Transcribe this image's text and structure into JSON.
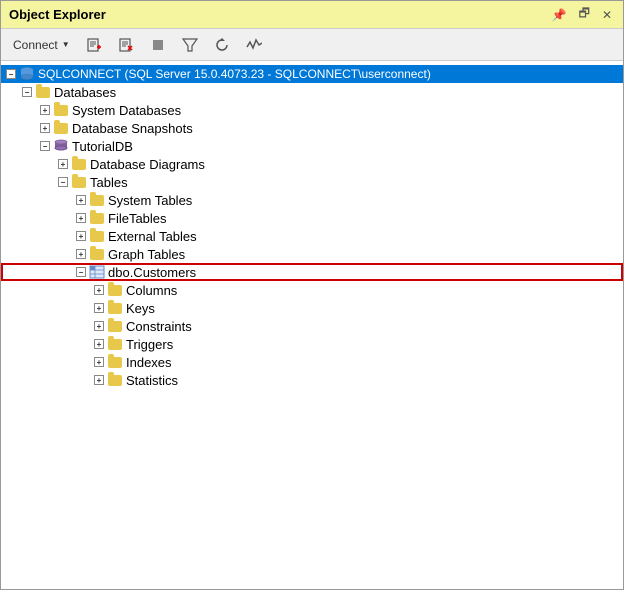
{
  "window": {
    "title": "Object Explorer",
    "pin_label": "📌",
    "restore_label": "🗗",
    "close_label": "✕"
  },
  "toolbar": {
    "connect_label": "Connect",
    "icons": [
      "filter-icon",
      "filter-connections-icon",
      "stop-icon",
      "filter2-icon",
      "refresh-icon",
      "activity-icon"
    ]
  },
  "tree": {
    "server": {
      "label": "SQLCONNECT (SQL Server 15.0.4073.23 - SQLCONNECT\\userconnect)",
      "expanded": true,
      "children": {
        "databases": {
          "label": "Databases",
          "expanded": true,
          "children": {
            "system_databases": {
              "label": "System Databases",
              "expanded": false
            },
            "database_snapshots": {
              "label": "Database Snapshots",
              "expanded": false
            },
            "tutorialdb": {
              "label": "TutorialDB",
              "expanded": true,
              "children": {
                "database_diagrams": {
                  "label": "Database Diagrams",
                  "expanded": false
                },
                "tables": {
                  "label": "Tables",
                  "expanded": true,
                  "children": {
                    "system_tables": {
                      "label": "System Tables",
                      "expanded": false
                    },
                    "file_tables": {
                      "label": "FileTables",
                      "expanded": false
                    },
                    "external_tables": {
                      "label": "External Tables",
                      "expanded": false
                    },
                    "graph_tables": {
                      "label": "Graph Tables",
                      "expanded": false
                    },
                    "dbo_customers": {
                      "label": "dbo.Customers",
                      "expanded": true,
                      "highlighted": true,
                      "children": {
                        "columns": {
                          "label": "Columns",
                          "expanded": false
                        },
                        "keys": {
                          "label": "Keys",
                          "expanded": false
                        },
                        "constraints": {
                          "label": "Constraints",
                          "expanded": false
                        },
                        "triggers": {
                          "label": "Triggers",
                          "expanded": false
                        },
                        "indexes": {
                          "label": "Indexes",
                          "expanded": false
                        },
                        "statistics": {
                          "label": "Statistics",
                          "expanded": false
                        }
                      }
                    }
                  }
                }
              }
            }
          }
        }
      }
    }
  }
}
